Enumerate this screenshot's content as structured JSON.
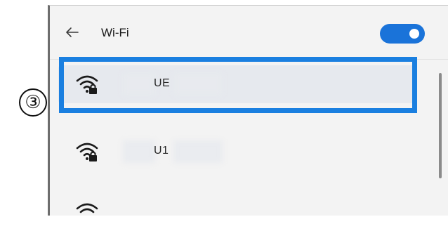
{
  "step_marker": "③",
  "header": {
    "back_icon": "arrow-left-icon",
    "title": "Wi-Fi",
    "toggle_state": "on"
  },
  "colors": {
    "accent": "#1a73d9",
    "highlight": "#1a7fe0",
    "panel_bg": "#f3f3f3"
  },
  "networks": [
    {
      "name": "UE",
      "icon": "secured-wifi-icon",
      "selected": true
    },
    {
      "name": "U1",
      "icon": "secured-wifi-icon",
      "selected": false
    },
    {
      "name": "",
      "icon": "secured-wifi-icon",
      "selected": false
    }
  ]
}
